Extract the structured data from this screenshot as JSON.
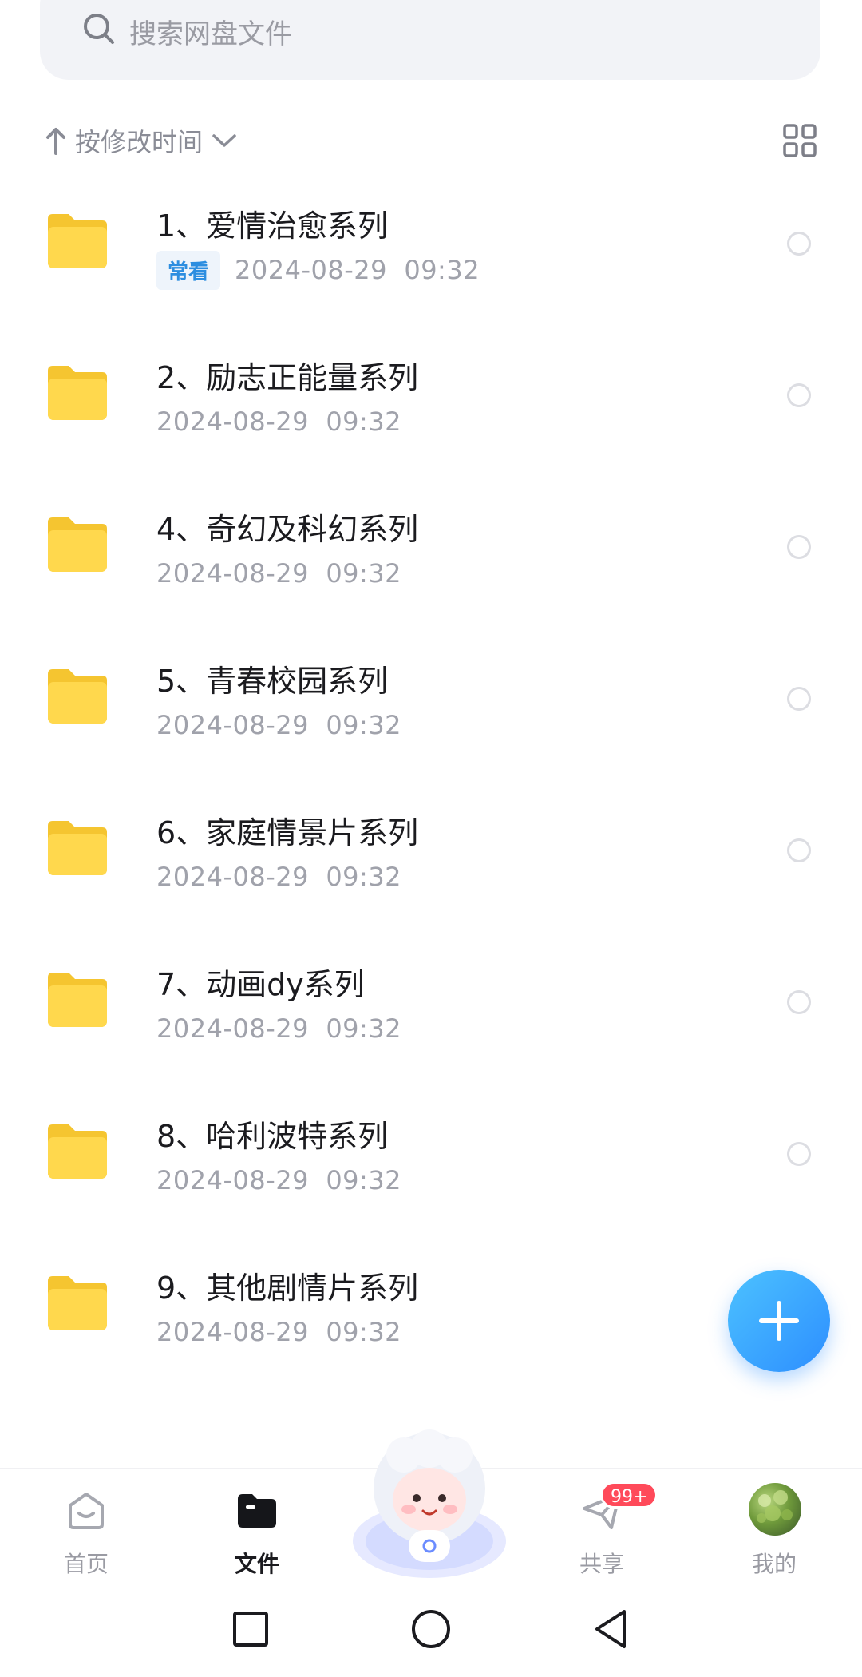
{
  "search": {
    "placeholder": "搜索网盘文件"
  },
  "sort": {
    "label": "按修改时间"
  },
  "files": [
    {
      "name": "1、爱情治愈系列",
      "tag": "常看",
      "date": "2024-08-29  09:32"
    },
    {
      "name": "2、励志正能量系列",
      "date": "2024-08-29  09:32"
    },
    {
      "name": "4、奇幻及科幻系列",
      "date": "2024-08-29  09:32"
    },
    {
      "name": "5、青春校园系列",
      "date": "2024-08-29  09:32"
    },
    {
      "name": "6、家庭情景片系列",
      "date": "2024-08-29  09:32"
    },
    {
      "name": "7、动画dy系列",
      "date": "2024-08-29  09:32"
    },
    {
      "name": "8、哈利波特系列",
      "date": "2024-08-29  09:32"
    },
    {
      "name": "9、其他剧情片系列",
      "date": "2024-08-29  09:32"
    }
  ],
  "tabs": [
    {
      "label": "首页",
      "icon": "home-icon",
      "active": false
    },
    {
      "label": "文件",
      "icon": "folder-icon",
      "active": true
    },
    {
      "label": "共享",
      "icon": "paper-plane-icon",
      "active": false,
      "badge": "99+"
    },
    {
      "label": "我的",
      "icon": "avatar",
      "active": false
    }
  ],
  "colors": {
    "accent": "#2d8eff",
    "folder": "#ffd64a",
    "badge": "#ff4a5a"
  }
}
